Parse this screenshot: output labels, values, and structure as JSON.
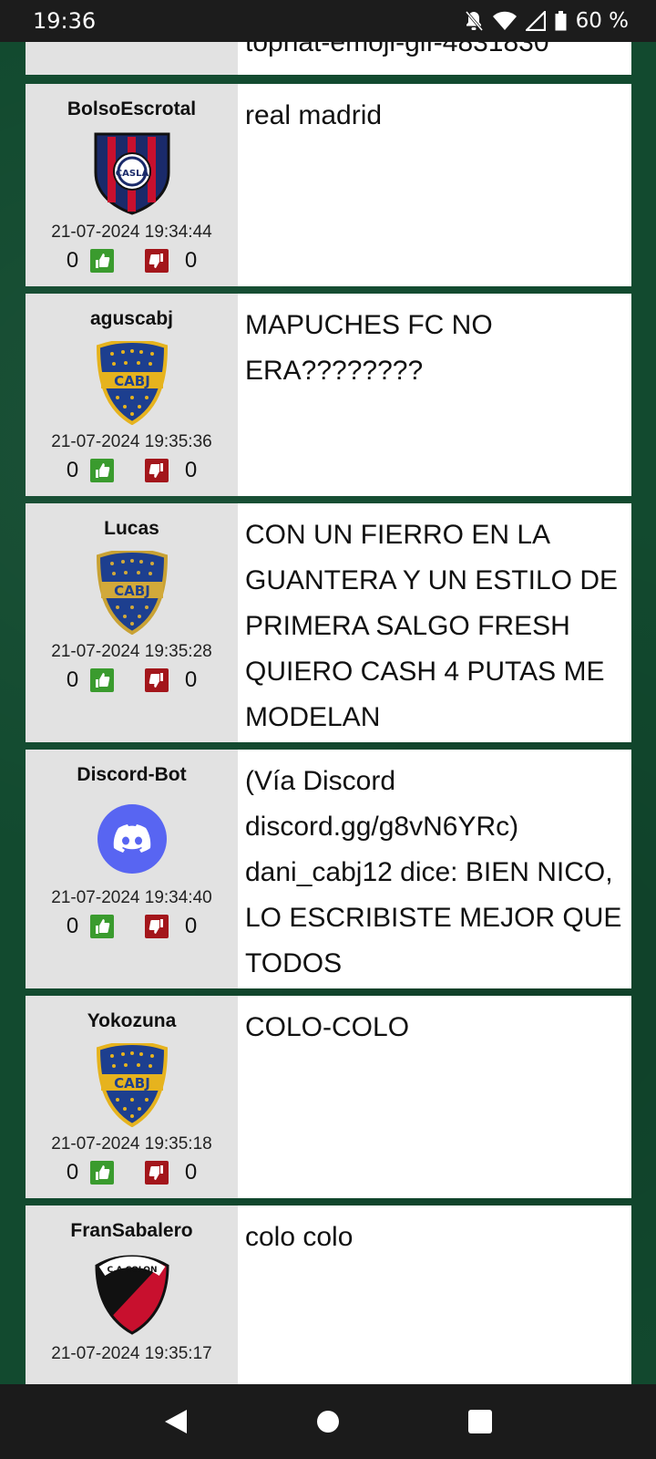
{
  "status": {
    "time": "19:36",
    "battery": "60 %"
  },
  "top_partial_text": "tophat-emoji-gif-4831830",
  "posts": [
    {
      "user": "BolsoEscrotal",
      "avatar": "san-lorenzo-crest",
      "date": "21-07-2024 19:34:44",
      "up": "0",
      "down": "0",
      "text": "real madrid"
    },
    {
      "user": "aguscabj",
      "avatar": "boca-juniors-crest",
      "date": "21-07-2024 19:35:36",
      "up": "0",
      "down": "0",
      "text": "MAPUCHES FC NO ERA????????"
    },
    {
      "user": "Lucas",
      "avatar": "boca-juniors-crest",
      "date": "21-07-2024 19:35:28",
      "up": "0",
      "down": "0",
      "text": "CON UN FIERRO EN LA GUANTERA Y UN ESTILO DE PRIMERA SALGO FRESH QUIERO CASH 4 PUTAS ME MODELAN"
    },
    {
      "user": "Discord-Bot",
      "avatar": "discord-logo",
      "date": "21-07-2024 19:34:40",
      "up": "0",
      "down": "0",
      "text": "(Vía Discord discord.gg/g8vN6YRc) dani_cabj12 dice: BIEN NICO, LO ESCRIBISTE MEJOR QUE TODOS"
    },
    {
      "user": "Yokozuna",
      "avatar": "boca-juniors-crest",
      "date": "21-07-2024 19:35:18",
      "up": "0",
      "down": "0",
      "text": "COLO-COLO"
    },
    {
      "user": "FranSabalero",
      "avatar": "colon-crest",
      "date": "21-07-2024 19:35:17",
      "up": "",
      "down": "",
      "text": "colo colo"
    }
  ],
  "badges": {
    "boca": "CABJ",
    "san_lorenzo": "CASLA",
    "colon": "C.A COLON"
  },
  "colors": {
    "thumb_up": "#3a9b2e",
    "thumb_down": "#a3161b",
    "background": "#124a2f"
  }
}
